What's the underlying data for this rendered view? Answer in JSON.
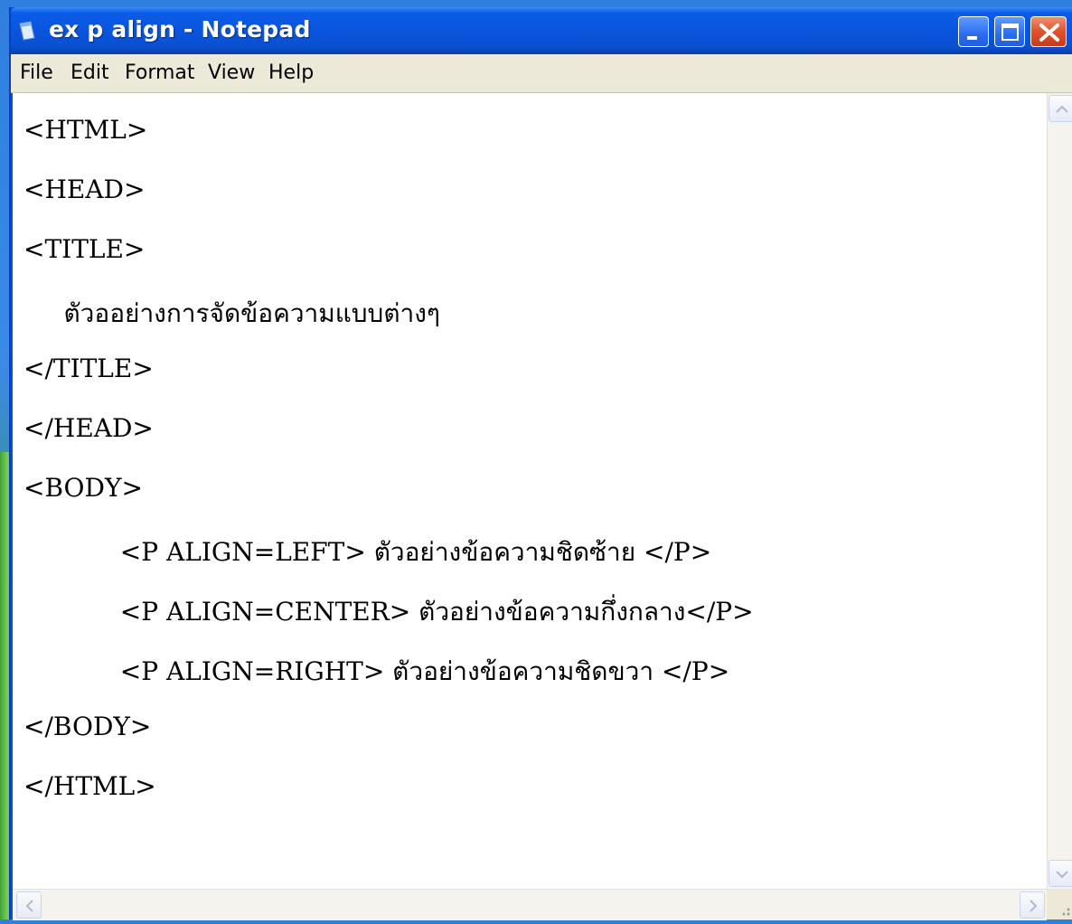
{
  "window": {
    "title": "ex p align - Notepad",
    "icon": "notepad-icon"
  },
  "menu": {
    "file": "File",
    "edit": "Edit",
    "format": "Format",
    "view": "View",
    "help": "Help"
  },
  "editor": {
    "lines": [
      "<HTML>",
      "<HEAD>",
      "<TITLE>",
      "     ตัวออย่างการจัดข้อความแบบต่างๆ",
      "</TITLE>",
      "</HEAD>",
      "<BODY>",
      "            <P ALIGN=LEFT> ตัวอย่างข้อความชิดซ้าย </P>",
      "            <P ALIGN=CENTER> ตัวอย่างข้อความกึ่งกลาง</P>",
      "            <P ALIGN=RIGHT> ตัวอย่างข้อความชิดขวา </P>",
      "</BODY>",
      "</HTML>"
    ]
  },
  "colors": {
    "titlebar": "#0a55de",
    "menubar": "#ece9d8",
    "close": "#e0502a"
  },
  "icons": [
    "minimize-icon",
    "maximize-icon",
    "close-icon",
    "scroll-up-icon",
    "scroll-down-icon",
    "scroll-left-icon",
    "scroll-right-icon",
    "resize-grip-icon"
  ]
}
